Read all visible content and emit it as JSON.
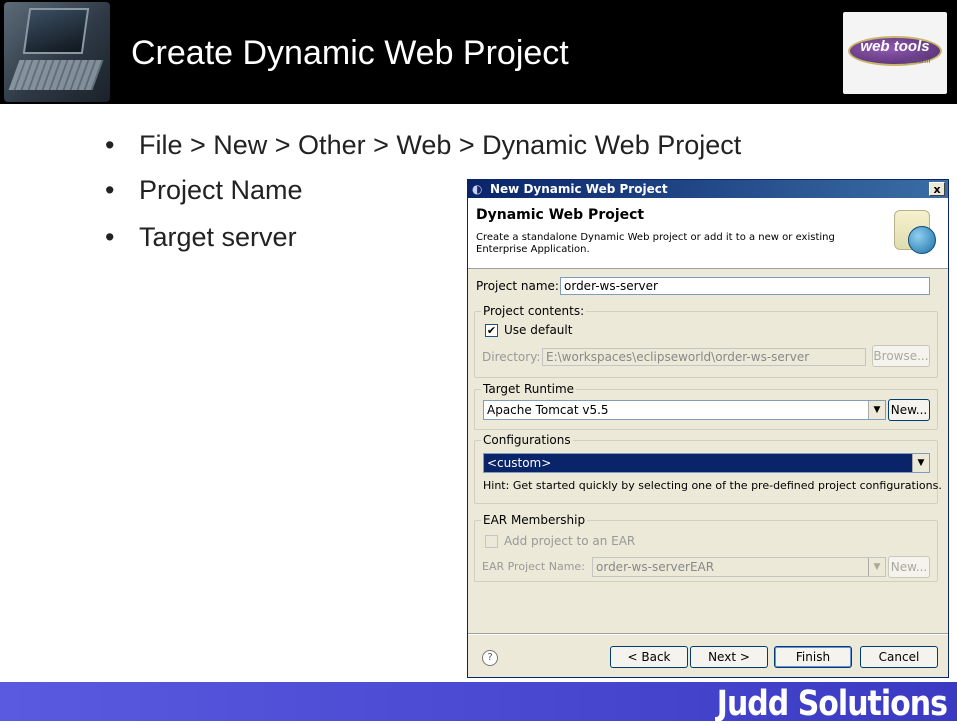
{
  "slide": {
    "title": "Create Dynamic Web Project",
    "logo_text": "web tools",
    "logo_sub": "platform",
    "bullets": [
      "File > New > Other > Web > Dynamic Web Project",
      "Project Name",
      "Target server"
    ],
    "brand": "Judd Solutions"
  },
  "dialog": {
    "window_title": "New Dynamic Web Project",
    "heading": "Dynamic Web Project",
    "description": "Create a standalone Dynamic Web project or add it to a new or existing Enterprise Application.",
    "project_name_label": "Project name:",
    "project_name_value": "order-ws-server",
    "project_contents_label": "Project contents:",
    "use_default_label": "Use default",
    "use_default_checked": "✔",
    "directory_label": "Directory:",
    "directory_value": "E:\\workspaces\\eclipseworld\\order-ws-server",
    "browse_label": "Browse...",
    "target_runtime_label": "Target Runtime",
    "target_runtime_value": "Apache Tomcat v5.5",
    "new_runtime_label": "New...",
    "configurations_label": "Configurations",
    "configurations_value": "<custom>",
    "hint": "Hint: Get started quickly by selecting one of the pre-defined project configurations.",
    "ear_membership_label": "EAR Membership",
    "add_to_ear_label": "Add project to an EAR",
    "ear_project_name_label": "EAR Project Name:",
    "ear_project_name_value": "order-ws-serverEAR",
    "ear_new_label": "New...",
    "help_icon": "?",
    "back_label": "< Back",
    "next_label": "Next >",
    "finish_label": "Finish",
    "cancel_label": "Cancel",
    "close_label": "x"
  }
}
